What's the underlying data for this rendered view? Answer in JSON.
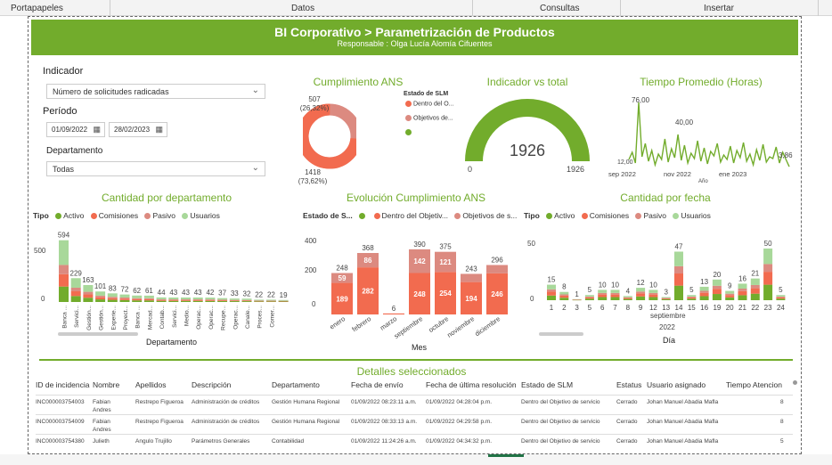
{
  "ribbon": {
    "items": [
      "Portapapeles",
      "Datos",
      "Consultas",
      "Insertar"
    ]
  },
  "banner": {
    "title": "BI Corporativo > Parametrización de Productos",
    "subtitle": "Responsable : Olga Lucía Alomía Cifuentes"
  },
  "filters": {
    "indicador_label": "Indicador",
    "indicador_value": "Número de solicitudes radicadas",
    "periodo_label": "Período",
    "date_from": "01/09/2022",
    "date_to": "28/02/2023",
    "departamento_label": "Departamento",
    "departamento_value": "Todas"
  },
  "colors": {
    "green": "#72ac2c",
    "orange": "#f26b4f",
    "pink": "#dc8a80",
    "light_green": "#a8d89a"
  },
  "ans": {
    "title": "Cumplimiento ANS",
    "legend_title": "Estado de SLM",
    "legend": [
      "Dentro del O...",
      "Objetivos de..."
    ],
    "slice_a_label": "507",
    "slice_a_pct": "(26,32%)",
    "slice_b_label": "1418",
    "slice_b_pct": "(73,62%)",
    "values": [
      1418,
      507
    ]
  },
  "gauge": {
    "title": "Indicador vs total",
    "value": "1926",
    "min": "0",
    "max": "1926",
    "fraction": 1.0
  },
  "tiempo": {
    "title": "Tiempo Promedio (Horas)",
    "peak_label": "76,00",
    "mid_label": "40,00",
    "start_label": "12,00",
    "end_label": "3,86",
    "x_ticks": [
      "sep 2022",
      "nov 2022",
      "ene 2023"
    ],
    "x_axis": "Año"
  },
  "dept": {
    "title": "Cantidad por departamento",
    "legend_label": "Tipo",
    "legend": [
      "Activo",
      "Comisiones",
      "Pasivo",
      "Usuarios"
    ],
    "y_ticks": [
      "500",
      "0"
    ],
    "x_axis": "Departamento",
    "categories": [
      "Banca ...",
      "Servici...",
      "Gestión...",
      "Gestión...",
      "Experie...",
      "Proyect...",
      "Banca ...",
      "Mercad...",
      "Contab...",
      "Servici...",
      "Medio...",
      "Operac...",
      "Operac...",
      "Recupe...",
      "Operac...",
      "Canale...",
      "Proces...",
      "Comer..."
    ],
    "totals": [
      "594",
      "229",
      "163",
      "101",
      "83",
      "72",
      "62",
      "61",
      "44",
      "43",
      "43",
      "43",
      "42",
      "37",
      "33",
      "32",
      "22",
      "22",
      "19"
    ]
  },
  "evo": {
    "title": "Evolución Cumplimiento ANS",
    "legend_label": "Estado de S...",
    "legend": [
      "Dentro del Objetiv...",
      "Objetivos de s..."
    ],
    "y_ticks": [
      "400",
      "200",
      "0"
    ],
    "x_axis": "Mes",
    "months": [
      "enero",
      "febrero",
      "marzo",
      "septiembre",
      "octubre",
      "noviembre",
      "diciembre"
    ],
    "totals": [
      "248",
      "368",
      "6",
      "390",
      "375",
      "243",
      "296"
    ],
    "dentro": [
      "189",
      "282",
      "",
      "248",
      "254",
      "194",
      "246"
    ],
    "objetivos": [
      "59",
      "86",
      "",
      "142",
      "121",
      "",
      "50"
    ]
  },
  "fecha": {
    "title": "Cantidad por fecha",
    "legend_label": "Tipo",
    "legend": [
      "Activo",
      "Comisiones",
      "Pasivo",
      "Usuarios"
    ],
    "y_ticks": [
      "50",
      "0"
    ],
    "x_axis": "Día",
    "month_label": "septiembre",
    "year_label": "2022",
    "days": [
      "1",
      "2",
      "3",
      "5",
      "6",
      "7",
      "8",
      "9",
      "12",
      "13",
      "14",
      "15",
      "16",
      "19",
      "20",
      "21",
      "22",
      "23",
      "24"
    ],
    "values": [
      "15",
      "8",
      "1",
      "5",
      "10",
      "10",
      "4",
      "12",
      "10",
      "3",
      "47",
      "5",
      "13",
      "20",
      "9",
      "16",
      "21",
      "50",
      "5"
    ]
  },
  "detalles": {
    "title": "Detalles seleccionados",
    "headers": [
      "ID de incidencia",
      "Nombre",
      "Apellidos",
      "Descripción",
      "Departamento",
      "Fecha de envío",
      "Fecha de última resolución",
      "Estado de SLM",
      "Estatus",
      "Usuario asignado",
      "Tiempo Atencion"
    ],
    "rows": [
      [
        "INC000003754003",
        "Fabian Andres",
        "Restrepo Figueroa",
        "Administración de créditos",
        "Gestión Humana Regional",
        "01/09/2022 08:23:11 a.m.",
        "01/09/2022 04:28:04 p.m.",
        "Dentro del Objetivo de servicio",
        "Cerrado",
        "Johan Manuel Abadia Mafla",
        "8"
      ],
      [
        "INC000003754009",
        "Fabian Andres",
        "Restrepo Figueroa",
        "Administración de créditos",
        "Gestión Humana Regional",
        "01/09/2022 08:33:13 a.m.",
        "01/09/2022 04:29:58 p.m.",
        "Dentro del Objetivo de servicio",
        "Cerrado",
        "Johan Manuel Abadia Mafla",
        "8"
      ],
      [
        "INC000003754380",
        "Julieth",
        "Angulo Trujillo",
        "Parámetros Generales",
        "Contabilidad",
        "01/09/2022 11:24:26 a.m.",
        "01/09/2022 04:34:32 p.m.",
        "Dentro del Objetivo de servicio",
        "Cerrado",
        "Johan Manuel Abadia Mafla",
        "5"
      ]
    ]
  }
}
